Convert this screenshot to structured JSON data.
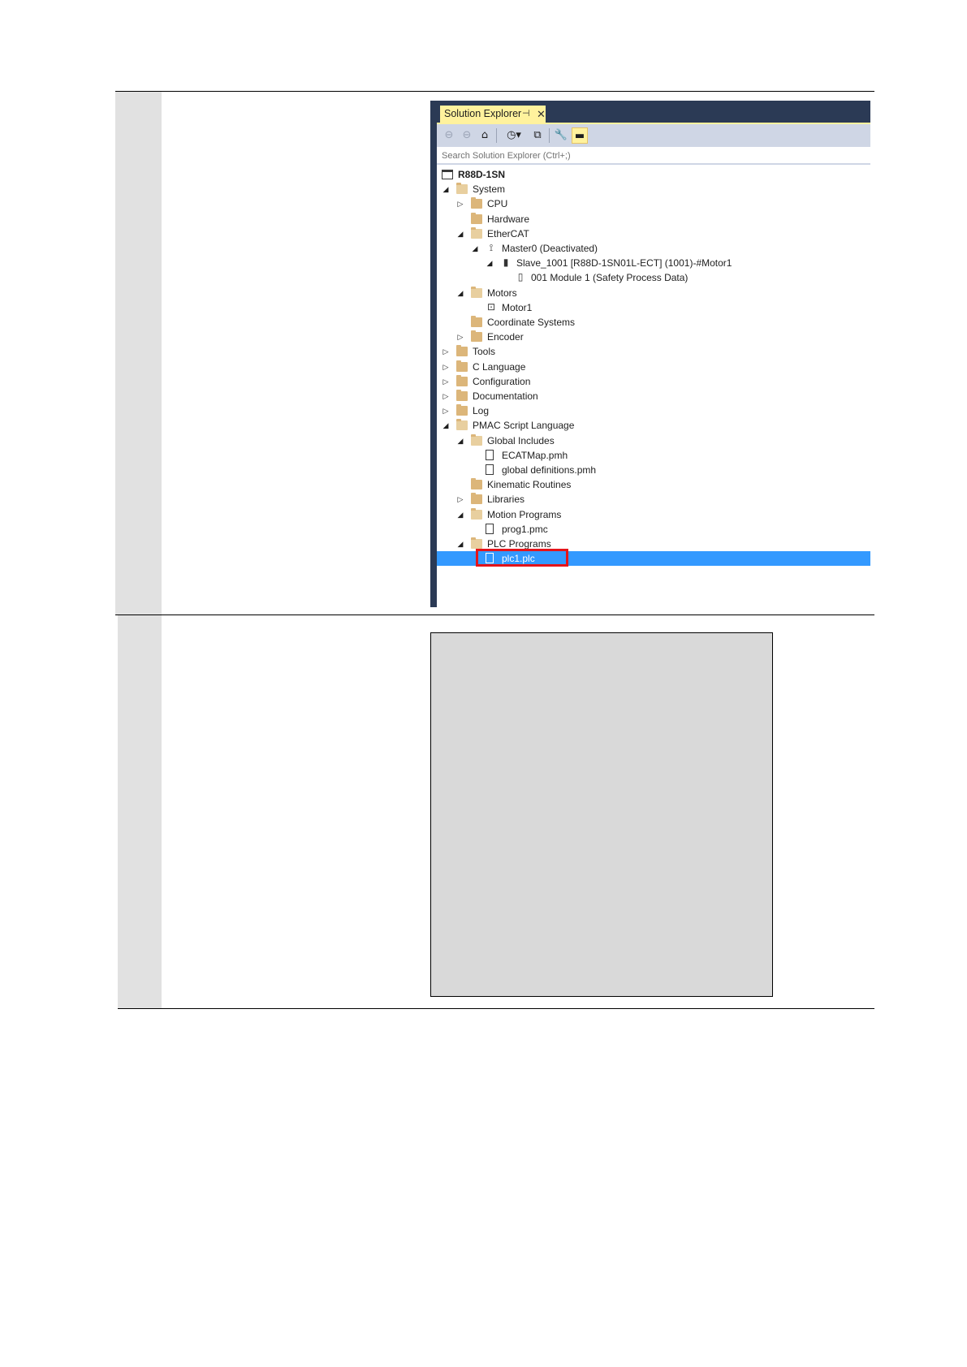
{
  "solution_explorer": {
    "tab_title": "Solution Explorer",
    "pin_glyph": "⊣",
    "close_glyph": "✕",
    "search_placeholder": "Search Solution Explorer (Ctrl+;)",
    "toolbar": [
      "back-icon",
      "forward-icon",
      "home-icon",
      "history-icon",
      "collapse-all-icon",
      "properties-wrench-icon",
      "preview-toggle-icon"
    ],
    "tree": [
      {
        "label": "R88D-1SN",
        "level": 0,
        "expander": "",
        "icon": "project-icon",
        "root": true
      },
      {
        "label": "System",
        "level": 0,
        "expander": "◢",
        "icon": "folder-open-icon"
      },
      {
        "label": "CPU",
        "level": 1,
        "expander": "▷",
        "icon": "folder-icon"
      },
      {
        "label": "Hardware",
        "level": 1,
        "expander": "",
        "icon": "folder-icon"
      },
      {
        "label": "EtherCAT",
        "level": 1,
        "expander": "◢",
        "icon": "folder-open-icon"
      },
      {
        "label": "Master0 (Deactivated)",
        "level": 2,
        "expander": "◢",
        "icon": "ethercat-master-icon"
      },
      {
        "label": "Slave_1001 [R88D-1SN01L-ECT] (1001)-#Motor1",
        "level": 3,
        "expander": "◢",
        "icon": "slave-device-icon"
      },
      {
        "label": "001 Module 1 (Safety Process Data)",
        "level": 4,
        "expander": "",
        "icon": "module-icon"
      },
      {
        "label": "Motors",
        "level": 1,
        "expander": "◢",
        "icon": "folder-open-icon"
      },
      {
        "label": "Motor1",
        "level": 2,
        "expander": "",
        "icon": "motor-icon"
      },
      {
        "label": "Coordinate Systems",
        "level": 1,
        "expander": "",
        "icon": "folder-icon"
      },
      {
        "label": "Encoder",
        "level": 1,
        "expander": "▷",
        "icon": "folder-icon"
      },
      {
        "label": "Tools",
        "level": 0,
        "expander": "▷",
        "icon": "folder-icon"
      },
      {
        "label": "C Language",
        "level": 0,
        "expander": "▷",
        "icon": "folder-icon"
      },
      {
        "label": "Configuration",
        "level": 0,
        "expander": "▷",
        "icon": "folder-icon"
      },
      {
        "label": "Documentation",
        "level": 0,
        "expander": "▷",
        "icon": "folder-icon"
      },
      {
        "label": "Log",
        "level": 0,
        "expander": "▷",
        "icon": "folder-icon"
      },
      {
        "label": "PMAC Script Language",
        "level": 0,
        "expander": "◢",
        "icon": "folder-open-icon"
      },
      {
        "label": "Global Includes",
        "level": 1,
        "expander": "◢",
        "icon": "folder-open-icon"
      },
      {
        "label": "ECATMap.pmh",
        "level": 2,
        "expander": "",
        "icon": "file-icon"
      },
      {
        "label": "global definitions.pmh",
        "level": 2,
        "expander": "",
        "icon": "file-icon"
      },
      {
        "label": "Kinematic Routines",
        "level": 1,
        "expander": "",
        "icon": "folder-icon"
      },
      {
        "label": "Libraries",
        "level": 1,
        "expander": "▷",
        "icon": "folder-icon"
      },
      {
        "label": "Motion Programs",
        "level": 1,
        "expander": "◢",
        "icon": "folder-open-icon"
      },
      {
        "label": "prog1.pmc",
        "level": 2,
        "expander": "",
        "icon": "file-icon"
      },
      {
        "label": "PLC Programs",
        "level": 1,
        "expander": "◢",
        "icon": "folder-open-icon"
      },
      {
        "label": "plc1.plc",
        "level": 2,
        "expander": "",
        "icon": "file-icon",
        "selected": true
      }
    ]
  },
  "colors": {
    "title_bar": "#2b3a55",
    "tab_active": "#fff29d",
    "selection": "#3399ff",
    "highlight_box": "#e5141a",
    "placeholder": "#d9d9d9"
  }
}
